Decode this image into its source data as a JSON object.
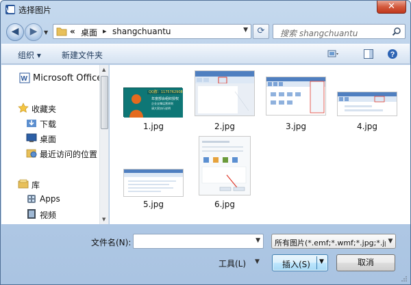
{
  "window": {
    "title": "选择图片",
    "close_label": "✕"
  },
  "address": {
    "crumbs": [
      "«",
      "桌面",
      "shangchuantu"
    ],
    "search_placeholder": "搜索 shangchuantu"
  },
  "toolbar": {
    "organize": "组织 ▾",
    "new_folder": "新建文件夹"
  },
  "nav": {
    "items": [
      {
        "label": "Microsoft Office",
        "icon": "word-icon"
      },
      {
        "label": "收藏夹",
        "icon": "star-icon"
      },
      {
        "label": "下载",
        "icon": "download-folder-icon"
      },
      {
        "label": "桌面",
        "icon": "desktop-icon"
      },
      {
        "label": "最近访问的位置",
        "icon": "recent-places-icon"
      },
      {
        "label": "库",
        "icon": "library-icon"
      },
      {
        "label": "Apps",
        "icon": "apps-folder-icon"
      },
      {
        "label": "视频",
        "icon": "video-icon"
      }
    ]
  },
  "files": [
    {
      "name": "1.jpg"
    },
    {
      "name": "2.jpg"
    },
    {
      "name": "3.jpg"
    },
    {
      "name": "4.jpg"
    },
    {
      "name": "5.jpg"
    },
    {
      "name": "6.jpg"
    }
  ],
  "thumb1_text": {
    "qq": "QQ群：1175762908",
    "line1": "年度部会组织授权",
    "line2": "企业支撑运营原则",
    "line3": "请大家执行说明"
  },
  "bottom": {
    "filename_label": "文件名(N):",
    "filename_value": "",
    "filetype_value": "所有图片(*.emf;*.wmf;*.jpg;*.jp",
    "tools_label": "工具(L)",
    "insert_label": "插入(S)",
    "cancel_label": "取消"
  },
  "colors": {
    "frame": "#b6cde7",
    "selection_blue": "#3c7fb1"
  }
}
